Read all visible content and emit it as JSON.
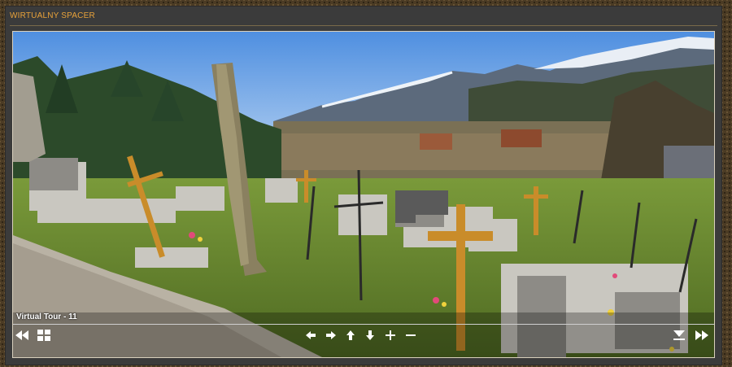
{
  "panel": {
    "title": "WIRTUALNY SPACER"
  },
  "viewer": {
    "caption": "Virtual Tour - 11",
    "controls": {
      "left": [
        "rewind-icon",
        "grid-icon"
      ],
      "center": [
        "arrow-left-icon",
        "arrow-right-icon",
        "arrow-up-icon",
        "arrow-down-icon",
        "zoom-in-icon",
        "zoom-out-icon"
      ],
      "right": [
        "menu-down-icon",
        "fast-forward-icon"
      ]
    }
  },
  "colors": {
    "title": "#e8a23a",
    "panel_bg": "#3b3b3b",
    "sky": "#6aa0e6"
  }
}
